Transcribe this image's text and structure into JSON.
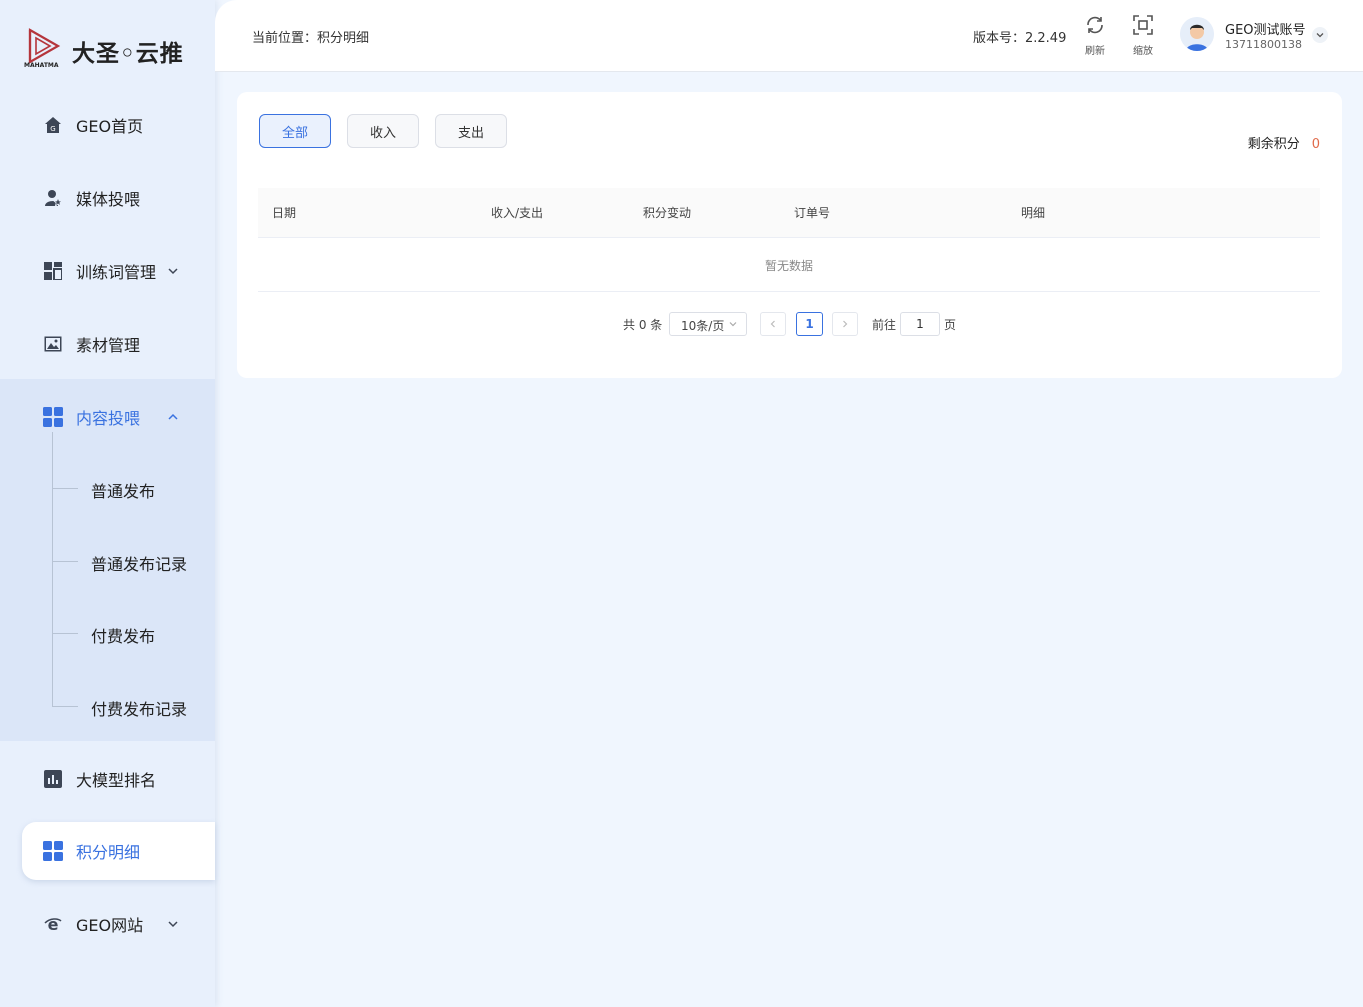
{
  "brand": {
    "name": "大圣◦云推",
    "sub": "MAHATMA"
  },
  "sidebar": {
    "items": [
      {
        "label": "GEO首页"
      },
      {
        "label": "媒体投喂"
      },
      {
        "label": "训练词管理"
      },
      {
        "label": "素材管理"
      },
      {
        "label": "内容投喂"
      },
      {
        "label": "大模型排名"
      },
      {
        "label": "积分明细"
      },
      {
        "label": "GEO网站"
      }
    ],
    "sub_items": [
      {
        "label": "普通发布"
      },
      {
        "label": "普通发布记录"
      },
      {
        "label": "付费发布"
      },
      {
        "label": "付费发布记录"
      }
    ]
  },
  "header": {
    "breadcrumb": "当前位置：积分明细",
    "version": "版本号：2.2.49",
    "refresh_label": "刷新",
    "zoom_label": "缩放",
    "user_name": "GEO测试账号",
    "user_phone": "13711800138"
  },
  "main": {
    "tabs": [
      {
        "label": "全部"
      },
      {
        "label": "收入"
      },
      {
        "label": "支出"
      }
    ],
    "remaining_label": "剩余积分",
    "remaining_value": "0",
    "columns": [
      "日期",
      "收入/支出",
      "积分变动",
      "订单号",
      "明细"
    ],
    "empty_text": "暂无数据",
    "pagination": {
      "total": "共 0 条",
      "page_size": "10条/页",
      "current_page": "1",
      "goto_label": "前往",
      "goto_value": "1",
      "page_suffix": "页"
    }
  },
  "colors": {
    "accent": "#3a72e0",
    "remaining": "#e06a4a"
  }
}
